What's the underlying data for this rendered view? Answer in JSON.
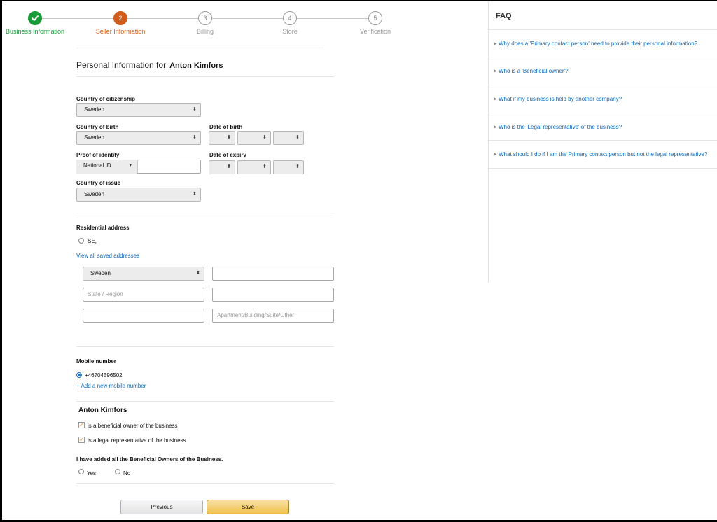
{
  "stepper": {
    "steps": [
      {
        "num": "",
        "label": "Business Information",
        "state": "done"
      },
      {
        "num": "2",
        "label": "Seller Information",
        "state": "current"
      },
      {
        "num": "3",
        "label": "Billing",
        "state": "pending"
      },
      {
        "num": "4",
        "label": "Store",
        "state": "pending"
      },
      {
        "num": "5",
        "label": "Verification",
        "state": "pending"
      }
    ]
  },
  "form": {
    "title": "Personal Information for",
    "person_name": "Anton Kimfors",
    "country_citizenship_label": "Country of citizenship",
    "country_citizenship_value": "Sweden",
    "country_birth_label": "Country of birth",
    "country_birth_value": "Sweden",
    "date_birth_label": "Date of birth",
    "proof_identity_label": "Proof of identity",
    "proof_identity_value": "National ID",
    "date_expiry_label": "Date of expiry",
    "country_issue_label": "Country of issue",
    "country_issue_value": "Sweden",
    "residential_label": "Residential address",
    "saved_address": "SE,",
    "view_saved": "View all saved addresses",
    "address_country": "Sweden",
    "state_placeholder": "State / Region",
    "apartment_placeholder": "Apartment/Building/Suite/Other",
    "mobile_label": "Mobile number",
    "mobile_value": "+46704596502",
    "add_mobile": "+ Add a new mobile number",
    "owner_name": "Anton Kimfors",
    "beneficial_owner": "is a beneficial owner of the business",
    "legal_rep": "is a legal representative of the business",
    "all_owners_question": "I have added all the Beneficial Owners of the Business.",
    "yes": "Yes",
    "no": "No",
    "previous": "Previous",
    "save": "Save"
  },
  "faq": {
    "title": "FAQ",
    "items": [
      "Why does a 'Primary contact person' need to provide their personal information?",
      "Who is a 'Beneficial owner'?",
      "What if my business is held by another company?",
      "Who is the 'Legal representative' of the business?",
      "What should I do if I am the Primary contact person but not the legal representative?"
    ]
  },
  "colors": {
    "done": "#1a9b3a",
    "current": "#d05b1a",
    "link": "#0a66b8",
    "save_button": "#f0c14b",
    "checkbox": "#e47911"
  }
}
